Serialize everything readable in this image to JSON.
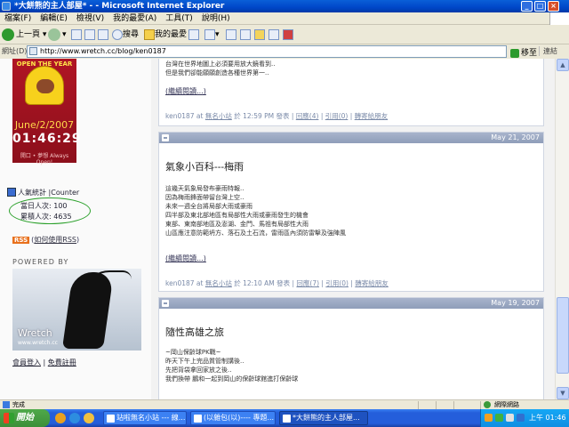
{
  "window": {
    "title": "*大餅熊的主人部屋* - - Microsoft Internet Explorer"
  },
  "menu": [
    "檔案(F)",
    "編輯(E)",
    "檢視(V)",
    "我的最愛(A)",
    "工具(T)",
    "說明(H)"
  ],
  "toolbar": {
    "back": "上一頁",
    "search": "搜尋",
    "favorites": "我的最愛"
  },
  "address": {
    "label": "網址(D)",
    "url": "http://www.wretch.cc/blog/ken0187",
    "go": "移至",
    "links": "連結"
  },
  "sidebar": {
    "clock": {
      "caption": "OPEN THE YEAR",
      "date": "June/2/2007",
      "time": "01:46:29",
      "subtitle": "開口 • 夢想 Always Open!"
    },
    "stats": {
      "title": "人氣統計 |Counter",
      "today": "當日人次: 100",
      "total": "累積人次: 4635"
    },
    "rss": {
      "badge": "RSS",
      "link": "如何使用RSS"
    },
    "powered_by": "POWERED BY",
    "banner": {
      "name": "Wretch",
      "url": "www.wretch.cc"
    },
    "login": "會員登入",
    "register": "免費註冊"
  },
  "posts": [
    {
      "body": [
        "台灣在世界地圖上必須要用放大鏡看到..",
        "但是我們卻能願願創造各種世界第一.."
      ],
      "more": "(繼續閱讀...)",
      "meta": {
        "author": "ken0187",
        "at": "at",
        "category": "無名小站",
        "time": "於 12:59 PM 發表",
        "reply": "回應(4)",
        "trackback": "引用(0)",
        "share": "轉寄給朋友"
      }
    },
    {
      "date": "May 21, 2007",
      "title": "氣象小百科---梅雨",
      "body": [
        "這幾天氣象局發布豪雨特報..",
        "因為梅雨鋒面帶留台灣上空..",
        "未來一週全台將局部大雨或豪雨",
        "四半部及東北部地區有局部性大雨或豪雨發生的機會",
        "東部、東南部地區及澎湖、金門、馬祖有局部性大雨",
        "山區應注意防範坍方、落石及土石流，雷雨區內須防雷擊及強陣風"
      ],
      "more": "(繼續閱讀...)",
      "meta": {
        "author": "ken0187",
        "at": "at",
        "category": "無名小站",
        "time": "於 12:10 AM 發表",
        "reply": "回應(7)",
        "trackback": "引用(0)",
        "share": "轉寄給朋友"
      }
    },
    {
      "date": "May 19, 2007",
      "title": "隨性高雄之旅",
      "body": [
        "~岡山保齡球PK戰~",
        "昨天下午上完品質管制講後..",
        "先把背袋拿回家放之後..",
        "我們換帶 鵬和一起到岡山的保齡球館進打保齡球"
      ]
    }
  ],
  "statusbar": {
    "status": "完成",
    "zone": "網際網路"
  },
  "taskbar": {
    "start": "開始",
    "tasks": [
      "站啦無名小站 --- 線...",
      "(以雜包(以)---- 專題...",
      "*大餅熊的主人部屋..."
    ],
    "clock": "上午 01:46"
  }
}
